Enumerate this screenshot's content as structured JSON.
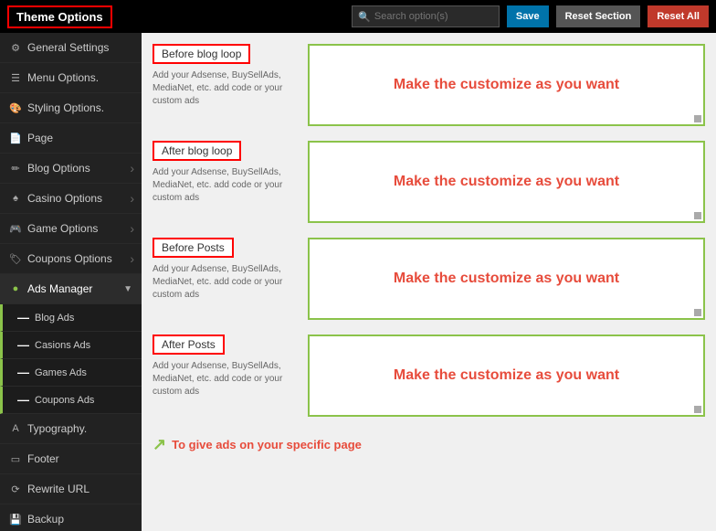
{
  "header": {
    "title": "Theme Options",
    "search_placeholder": "Search option(s)",
    "btn_save": "Save",
    "btn_reset": "Reset Section",
    "btn_reset_all": "Reset All"
  },
  "sidebar": {
    "items": [
      {
        "id": "general-settings",
        "icon": "⚙",
        "label": "General Settings",
        "has_arrow": false
      },
      {
        "id": "menu-options",
        "icon": "☰",
        "label": "Menu Options.",
        "has_arrow": false
      },
      {
        "id": "styling-options",
        "icon": "🎨",
        "label": "Styling Options.",
        "has_arrow": false
      },
      {
        "id": "page",
        "icon": "📄",
        "label": "Page",
        "has_arrow": false
      },
      {
        "id": "blog-options",
        "icon": "✏",
        "label": "Blog Options",
        "has_arrow": true
      },
      {
        "id": "casino-options",
        "icon": "🎰",
        "label": "Casino Options",
        "has_arrow": true
      },
      {
        "id": "game-options",
        "icon": "🎮",
        "label": "Game Options",
        "has_arrow": true
      },
      {
        "id": "coupons-options",
        "icon": "🏷",
        "label": "Coupons Options",
        "has_arrow": true
      },
      {
        "id": "ads-manager",
        "icon": "●",
        "label": "Ads Manager",
        "has_arrow": true,
        "active": true
      }
    ],
    "submenu": [
      {
        "id": "blog-ads",
        "label": "Blog Ads"
      },
      {
        "id": "casions-ads",
        "label": "Casions Ads"
      },
      {
        "id": "games-ads",
        "label": "Games Ads"
      },
      {
        "id": "coupons-ads",
        "label": "Coupons Ads"
      }
    ],
    "bottom_items": [
      {
        "id": "typography",
        "icon": "A",
        "label": "Typography."
      },
      {
        "id": "footer",
        "icon": "▭",
        "label": "Footer"
      },
      {
        "id": "rewrite-url",
        "icon": "⟳",
        "label": "Rewrite URL"
      },
      {
        "id": "backup",
        "icon": "💾",
        "label": "Backup"
      }
    ]
  },
  "main": {
    "sections": [
      {
        "id": "before-blog-loop",
        "title": "Before blog loop",
        "description": "Add your Adsense, BuySellAds, MediaNet, etc. add code or your custom ads",
        "placeholder": "Make the customize as you want"
      },
      {
        "id": "after-blog-loop",
        "title": "After blog loop",
        "description": "Add your Adsense, BuySellAds, MediaNet, etc. add code or your custom ads",
        "placeholder": "Make the customize as you want"
      },
      {
        "id": "before-posts",
        "title": "Before Posts",
        "description": "Add your Adsense, BuySellAds, MediaNet, etc. add code or your custom ads",
        "placeholder": "Make the customize as you want"
      },
      {
        "id": "after-posts",
        "title": "After Posts",
        "description": "Add your Adsense, BuySellAds, MediaNet, etc. add code or your custom ads",
        "placeholder": "Make the customize as you want"
      }
    ],
    "annotation": "To give ads on your specific page"
  }
}
